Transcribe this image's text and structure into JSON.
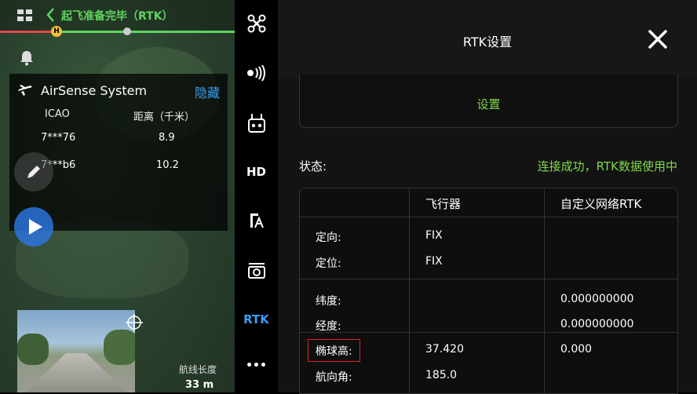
{
  "flight_status": "起飞准备完毕（RTK）",
  "home_marker": "H",
  "airsense": {
    "title": "AirSense System",
    "hide_label": "隐藏",
    "col_icao": "ICAO",
    "col_distance": "距离（千米）",
    "rows": [
      {
        "icao": "7***76",
        "distance": "8.9"
      },
      {
        "icao": "7***b6",
        "distance": "10.2"
      }
    ]
  },
  "pip": {
    "route_length_label": "航线长度",
    "route_length_value": "33 m"
  },
  "side_menu": [
    {
      "icon": "drone-icon"
    },
    {
      "icon": "signal-icon"
    },
    {
      "icon": "remote-controller-icon"
    },
    {
      "label": "HD"
    },
    {
      "icon": "flight-assist-icon"
    },
    {
      "icon": "camera-icon"
    },
    {
      "label": "RTK",
      "active": true
    },
    {
      "label": "•••"
    }
  ],
  "rtk_panel": {
    "title": "RTK设置",
    "settings_link": "设置",
    "status_label": "状态:",
    "status_value": "连接成功，RTK数据使用中",
    "table": {
      "col_aircraft": "飞行器",
      "col_custom_rtk": "自定义网络RTK",
      "rows": [
        {
          "label": "定向:",
          "aircraft": "FIX",
          "custom": ""
        },
        {
          "label": "定位:",
          "aircraft": "FIX",
          "custom": ""
        },
        {
          "label": "纬度:",
          "aircraft": "",
          "custom": "0.000000000"
        },
        {
          "label": "经度:",
          "aircraft": "",
          "custom": "0.000000000"
        },
        {
          "label": "椭球高:",
          "aircraft": "37.420",
          "custom": "0.000"
        },
        {
          "label": "航向角:",
          "aircraft": "185.0",
          "custom": ""
        }
      ]
    }
  },
  "colors": {
    "accent_green": "#7fd84b",
    "link_blue": "#3a9ef5",
    "highlight_red": "#e02020",
    "active_rtk": "#3a9ef5"
  }
}
